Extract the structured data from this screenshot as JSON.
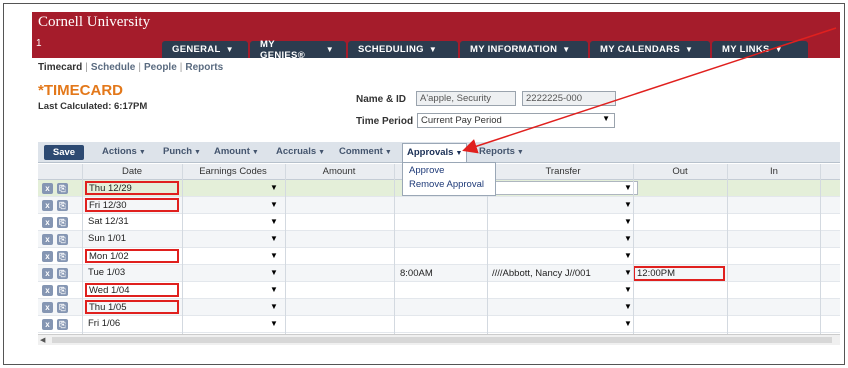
{
  "header": {
    "brand": "Cornell University",
    "band_number": "1",
    "tabs": [
      {
        "label": "GENERAL"
      },
      {
        "label": "MY GENIES®"
      },
      {
        "label": "SCHEDULING"
      },
      {
        "label": "MY INFORMATION"
      },
      {
        "label": "MY CALENDARS"
      },
      {
        "label": "MY LINKS"
      }
    ]
  },
  "subnav": {
    "timecard": "Timecard",
    "schedule": "Schedule",
    "people": "People",
    "reports": "Reports",
    "sep": "|"
  },
  "page": {
    "title": "*TIMECARD",
    "last_calculated": "Last Calculated: 6:17PM",
    "name_label": "Name & ID",
    "name_value": "A'apple, Security",
    "id_value": "2222225-000",
    "period_label": "Time Period",
    "period_value": "Current Pay Period"
  },
  "toolbar": {
    "save": "Save",
    "actions": "Actions",
    "punch": "Punch",
    "amount": "Amount",
    "accruals": "Accruals",
    "comment": "Comment",
    "approvals": "Approvals",
    "reports": "Reports"
  },
  "approvals_menu": {
    "items": [
      "Approve",
      "Remove Approval"
    ]
  },
  "grid": {
    "headers": {
      "date": "Date",
      "earnings": "Earnings Codes",
      "amount": "Amount",
      "transfer": "Transfer",
      "out": "Out",
      "in": "In"
    },
    "rows": [
      {
        "date": "Thu 12/29",
        "in_value": "",
        "transfer": "",
        "out": ""
      },
      {
        "date": "Fri 12/30",
        "in_value": "",
        "transfer": "",
        "out": ""
      },
      {
        "date": "Sat 12/31",
        "in_value": "",
        "transfer": "",
        "out": ""
      },
      {
        "date": "Sun 1/01",
        "in_value": "",
        "transfer": "",
        "out": ""
      },
      {
        "date": "Mon 1/02",
        "in_value": "",
        "transfer": "",
        "out": ""
      },
      {
        "date": "Tue 1/03",
        "in_value": "8:00AM",
        "transfer": "////Abbott, Nancy J//001",
        "out": "12:00PM"
      },
      {
        "date": "Wed 1/04",
        "in_value": "",
        "transfer": "",
        "out": ""
      },
      {
        "date": "Thu 1/05",
        "in_value": "",
        "transfer": "",
        "out": ""
      },
      {
        "date": "Fri 1/06",
        "in_value": "",
        "transfer": "",
        "out": ""
      }
    ]
  },
  "icons": {
    "delete_glyph": "x",
    "copy_glyph": "⎘",
    "caret": "▼",
    "scroll_left": "◀"
  },
  "colors": {
    "brand_red": "#a51c2b",
    "tab_navy": "#2c3c4f",
    "title_orange": "#e3781a",
    "highlight_red": "#e0201e"
  }
}
